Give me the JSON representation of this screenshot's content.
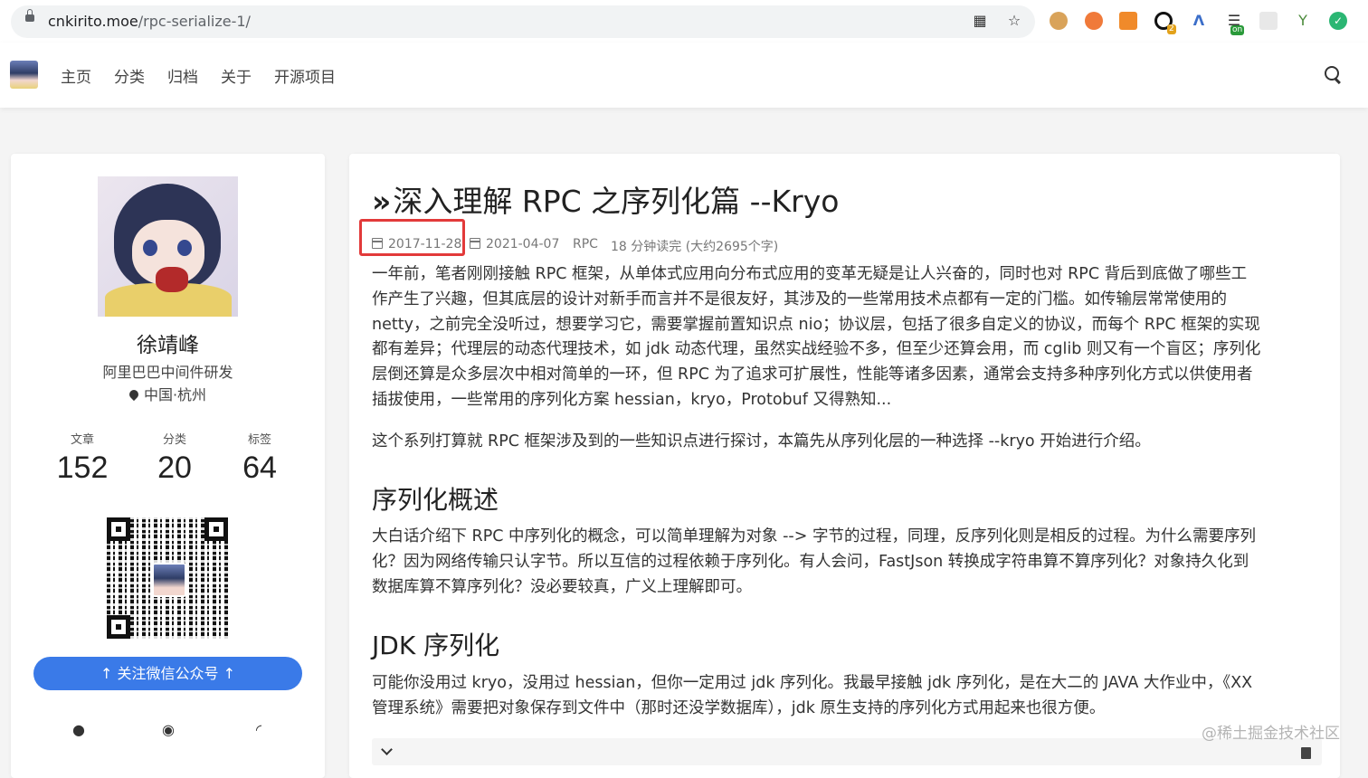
{
  "browser": {
    "url_domain": "cnkirito.moe",
    "url_path": "/rpc-serialize-1/",
    "ext_badges": [
      "2",
      "on"
    ]
  },
  "nav": {
    "links": [
      "主页",
      "分类",
      "归档",
      "关于",
      "开源项目"
    ]
  },
  "sidebar": {
    "name": "徐靖峰",
    "title": "阿里巴巴中间件研发",
    "location": "中国·杭州",
    "stats": [
      {
        "label": "文章",
        "value": "152"
      },
      {
        "label": "分类",
        "value": "20"
      },
      {
        "label": "标签",
        "value": "64"
      }
    ],
    "follow_button": "↑ 关注微信公众号 ↑"
  },
  "article": {
    "title": "深入理解 RPC 之序列化篇 --Kryo",
    "published": "2017-11-28",
    "updated": "2021-04-07",
    "category": "RPC",
    "read_time": "18 分钟读完 (大约2695个字)",
    "intro_lines": [
      "一年前，笔者刚刚接触 RPC 框架，从单体式应用向分布式应用的变革无疑是让人兴奋的，同时也对 RPC 背后到底做了哪些工",
      "作产生了兴趣，但其底层的设计对新手而言并不是很友好，其涉及的一些常用技术点都有一定的门槛。如传输层常常使用的",
      "netty，之前完全没听过，想要学习它，需要掌握前置知识点 nio；协议层，包括了很多自定义的协议，而每个 RPC 框架的实现",
      "都有差异；代理层的动态代理技术，如 jdk 动态代理，虽然实战经验不多，但至少还算会用，而 cglib 则又有一个盲区；序列化",
      "层倒还算是众多层次中相对简单的一环，但 RPC 为了追求可扩展性，性能等诸多因素，通常会支持多种序列化方式以供使用者",
      "插拔使用，一些常用的序列化方案 hessian，kryo，Protobuf 又得熟知..."
    ],
    "series_note": "这个系列打算就 RPC 框架涉及到的一些知识点进行探讨，本篇先从序列化层的一种选择 --kryo 开始进行介绍。",
    "section1_heading": "序列化概述",
    "section1_lines": [
      "大白话介绍下 RPC 中序列化的概念，可以简单理解为对象 --> 字节的过程，同理，反序列化则是相反的过程。为什么需要序列",
      "化？因为网络传输只认字节。所以互信的过程依赖于序列化。有人会问，FastJson 转换成字符串算不算序列化？对象持久化到",
      "数据库算不算序列化？没必要较真，广义上理解即可。"
    ],
    "section2_heading": "JDK 序列化",
    "section2_lines": [
      "可能你没用过 kryo，没用过 hessian，但你一定用过 jdk 序列化。我最早接触 jdk 序列化，是在大二的 JAVA 大作业中，《XX",
      "管理系统》需要把对象保存到文件中（那时还没学数据库），jdk 原生支持的序列化方式用起来也很方便。"
    ]
  },
  "watermark": "@稀土掘金技术社区",
  "colors": {
    "highlight_box": "#e23a3a",
    "follow_button": "#3a7ae8"
  }
}
